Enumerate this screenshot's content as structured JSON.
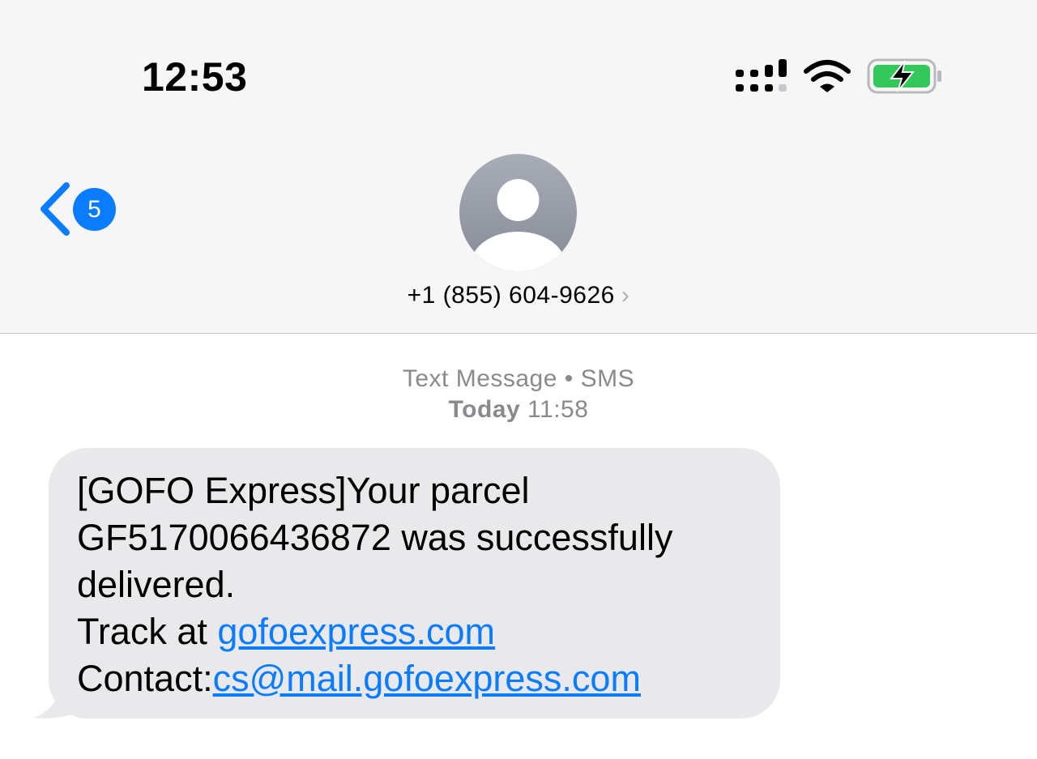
{
  "status_bar": {
    "time": "12:53",
    "icons": [
      "cellular-signal-icon",
      "wifi-icon",
      "battery-charging-icon"
    ],
    "battery_color": "#34c759"
  },
  "nav": {
    "back_icon": "chevron-left-icon",
    "unread_count": "5",
    "avatar_icon": "person-icon",
    "contact_number": "+1 (855) 604-9626",
    "contact_chevron": "›"
  },
  "thread": {
    "service_label": "Text Message",
    "separator": " • ",
    "service_type": "SMS",
    "day": "Today",
    "time": "11:58"
  },
  "message": {
    "line1": "[GOFO Express]Your parcel",
    "line2": "GF5170066436872 was successfully",
    "line3": "delivered.",
    "track_prefix": "Track at ",
    "track_link": "gofoexpress.com",
    "contact_prefix": "Contact:",
    "contact_link": "cs@mail.gofoexpress.com"
  },
  "colors": {
    "accent": "#0a7cff",
    "bubble": "#e9e9eb",
    "header": "#f6f6f6",
    "secondary_text": "#8a8a8e"
  }
}
